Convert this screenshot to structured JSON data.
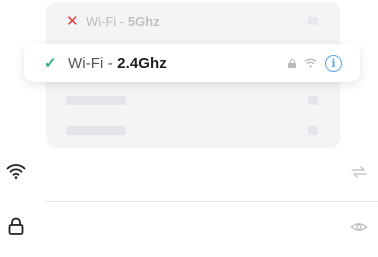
{
  "network_list": {
    "items": [
      {
        "status": "unavailable",
        "label_prefix": "Wi-Fi - ",
        "label_band": "5Ghz"
      },
      {
        "status": "selected",
        "label_prefix": "Wi-Fi - ",
        "label_band": "2.4Ghz"
      }
    ]
  },
  "form": {
    "ssid": {
      "value": "",
      "placeholder": "",
      "icon": "wifi-icon",
      "trailing_icon": "switch-icon"
    },
    "password": {
      "value": "",
      "placeholder": "",
      "icon": "lock-icon",
      "trailing_icon": "eye-icon"
    }
  },
  "colors": {
    "selected_check": "#2fb07a",
    "unavailable_x": "#e23b3b",
    "info_accent": "#5aa7e6"
  }
}
